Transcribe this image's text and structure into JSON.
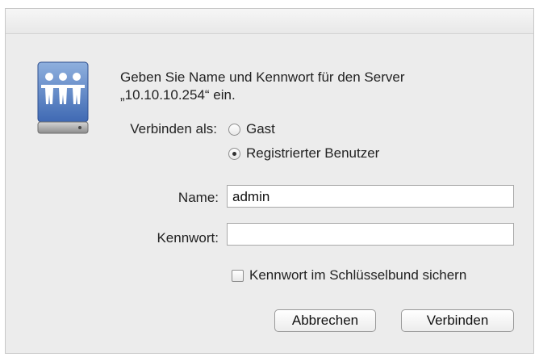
{
  "dialog": {
    "icon": "network-server-icon",
    "message_line1": "Geben Sie Name und Kennwort für den Server",
    "message_line2": "„10.10.10.254“ ein.",
    "connect_as_label": "Verbinden als:",
    "options": [
      {
        "label": "Gast",
        "selected": false
      },
      {
        "label": "Registrierter Benutzer",
        "selected": true
      }
    ],
    "name_label": "Name:",
    "name_value": "admin",
    "password_label": "Kennwort:",
    "password_value": "",
    "keychain_label": "Kennwort im Schlüsselbund sichern",
    "keychain_checked": false,
    "cancel_label": "Abbrechen",
    "connect_label": "Verbinden"
  }
}
